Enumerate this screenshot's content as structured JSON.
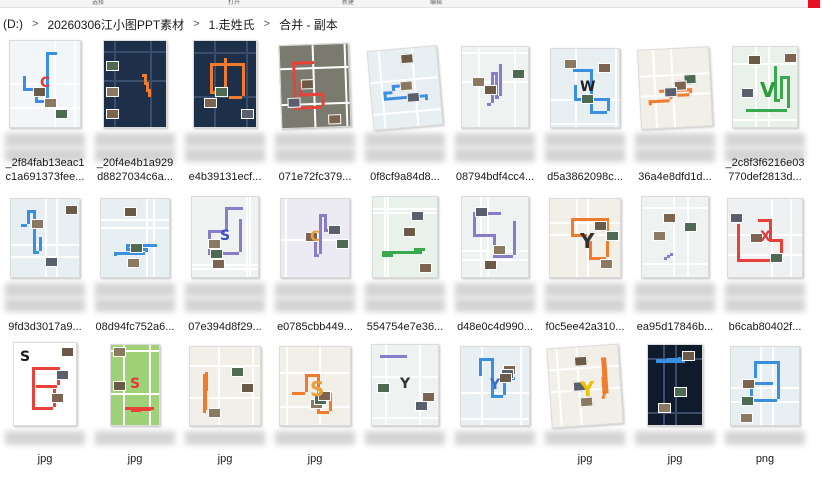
{
  "toolbar": {
    "segments": [
      "选择",
      "打开",
      "新建",
      "编辑"
    ]
  },
  "breadcrumb": [
    "(D:)",
    "20260306江小图PPT素材",
    "1.走姓氏",
    "合并 - 副本"
  ],
  "breadcrumb_separator": ">",
  "files": [
    {
      "line1": "_2f84fab13eac1",
      "line2": "c1a691373fee...",
      "style": "phone",
      "letter": "C",
      "letter_color": "#e03a3a"
    },
    {
      "line1": "_20f4e4b1a929",
      "line2": "d8827034c6a...",
      "style": "dark-sat",
      "letter": "",
      "letter_color": ""
    },
    {
      "line1": "",
      "line2": "e4b39131ecf...",
      "style": "dark-sat",
      "letter": "",
      "letter_color": ""
    },
    {
      "line1": "",
      "line2": "071e72fc379...",
      "style": "satellite",
      "letter": "",
      "letter_color": ""
    },
    {
      "line1": "",
      "line2": "0f8cf9a84d8...",
      "style": "map-blue",
      "letter": "",
      "letter_color": ""
    },
    {
      "line1": "",
      "line2": "08794bdf4cc4...",
      "style": "map-plain",
      "letter": "",
      "letter_color": ""
    },
    {
      "line1": "",
      "line2": "d5a3862098c...",
      "style": "map-blue",
      "letter": "W",
      "letter_color": "#222222"
    },
    {
      "line1": "",
      "line2": "36a4e8dfd1d...",
      "style": "map-orange",
      "letter": "",
      "letter_color": ""
    },
    {
      "line1": "_2c8f3f6216e03",
      "line2": "770def2813d...",
      "style": "map-green",
      "letter": "V",
      "letter_color": "#2e9b3a"
    },
    {
      "line1": "",
      "line2": "9fd3d3017a9...",
      "style": "map-blue",
      "letter": "",
      "letter_color": ""
    },
    {
      "line1": "",
      "line2": "08d94fc752a6...",
      "style": "map-blue",
      "letter": "",
      "letter_color": ""
    },
    {
      "line1": "",
      "line2": "07e394d8f29...",
      "style": "map-plain",
      "letter": "S",
      "letter_color": "#3a4cc9"
    },
    {
      "line1": "",
      "line2": "e0785cbb449...",
      "style": "map-purple",
      "letter": "C",
      "letter_color": "#e6a23c"
    },
    {
      "line1": "",
      "line2": "554754e7e36...",
      "style": "map-green",
      "letter": "",
      "letter_color": ""
    },
    {
      "line1": "",
      "line2": "d48e0c4d990...",
      "style": "map-plain",
      "letter": "",
      "letter_color": ""
    },
    {
      "line1": "",
      "line2": "f0c5ee42a310...",
      "style": "map-orange",
      "letter": "Y",
      "letter_color": "#333333"
    },
    {
      "line1": "",
      "line2": "ea95d17846b...",
      "style": "map-plain",
      "letter": "",
      "letter_color": ""
    },
    {
      "line1": "",
      "line2": "b6cab80402f...",
      "style": "map-red",
      "letter": "X",
      "letter_color": "#e03a3a"
    },
    {
      "line1": "",
      "line2": "jpg",
      "style": "yellow",
      "letter": "S",
      "letter_color": "#1a1a1a"
    },
    {
      "line1": "",
      "line2": "jpg",
      "style": "green",
      "letter": "S",
      "letter_color": "#e03a3a"
    },
    {
      "line1": "",
      "line2": "jpg",
      "style": "map-orange",
      "letter": "",
      "letter_color": ""
    },
    {
      "line1": "",
      "line2": "jpg",
      "style": "map-orange",
      "letter": "S",
      "letter_color": "#e6a23c"
    },
    {
      "line1": "",
      "line2": "",
      "style": "map-plain",
      "letter": "Y",
      "letter_color": "#333333"
    },
    {
      "line1": "",
      "line2": "",
      "style": "map-blue",
      "letter": "Y",
      "letter_color": "#3a6cc9"
    },
    {
      "line1": "",
      "line2": "jpg",
      "style": "map-orange",
      "letter": "Y",
      "letter_color": "#f0c000"
    },
    {
      "line1": "",
      "line2": "jpg",
      "style": "dark",
      "letter": "",
      "letter_color": ""
    },
    {
      "line1": "",
      "line2": "png",
      "style": "map-blue",
      "letter": "",
      "letter_color": ""
    }
  ],
  "thumb_colors": {
    "map_bg": "#e8eff2",
    "route_blue": "#3b8fe0",
    "route_orange": "#f07b2c",
    "route_purple": "#8a7cc9",
    "route_red": "#e8413a",
    "route_green": "#3aa84e"
  }
}
